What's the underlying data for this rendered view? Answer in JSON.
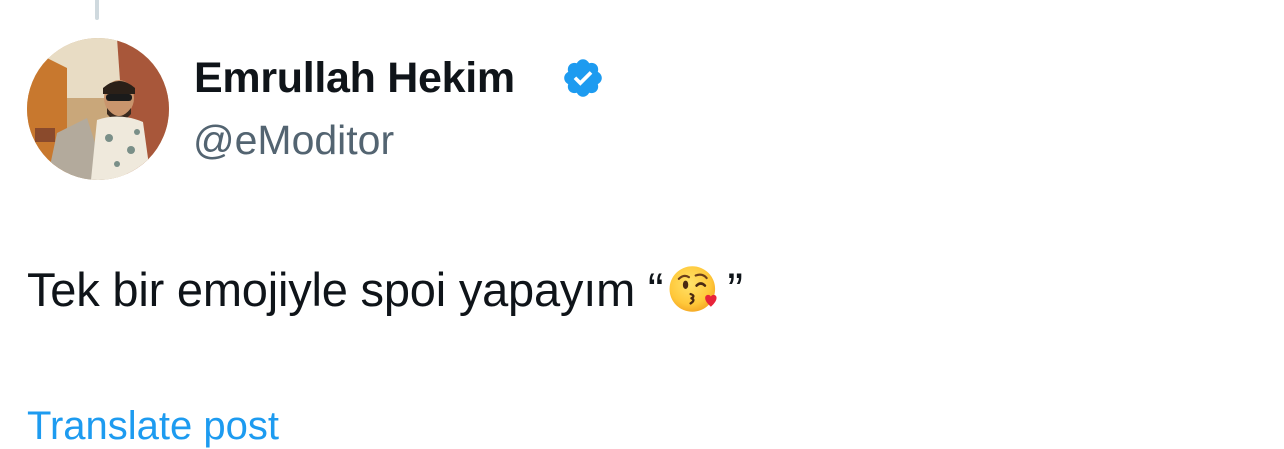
{
  "tweet": {
    "author": {
      "display_name": "Emrullah Hekim",
      "handle": "@eModitor",
      "verified": true,
      "verified_icon": "verified-badge-icon",
      "avatar": "profile-photo"
    },
    "text_before_emoji": "Tek bir emojiyle spoi yapayım “",
    "emoji": "face-blowing-a-kiss-icon",
    "text_after_emoji": "”",
    "translate_label": "Translate post"
  },
  "colors": {
    "text_primary": "#0f1419",
    "text_secondary": "#536471",
    "accent": "#1d9bf0",
    "verified": "#1d9bf0"
  }
}
